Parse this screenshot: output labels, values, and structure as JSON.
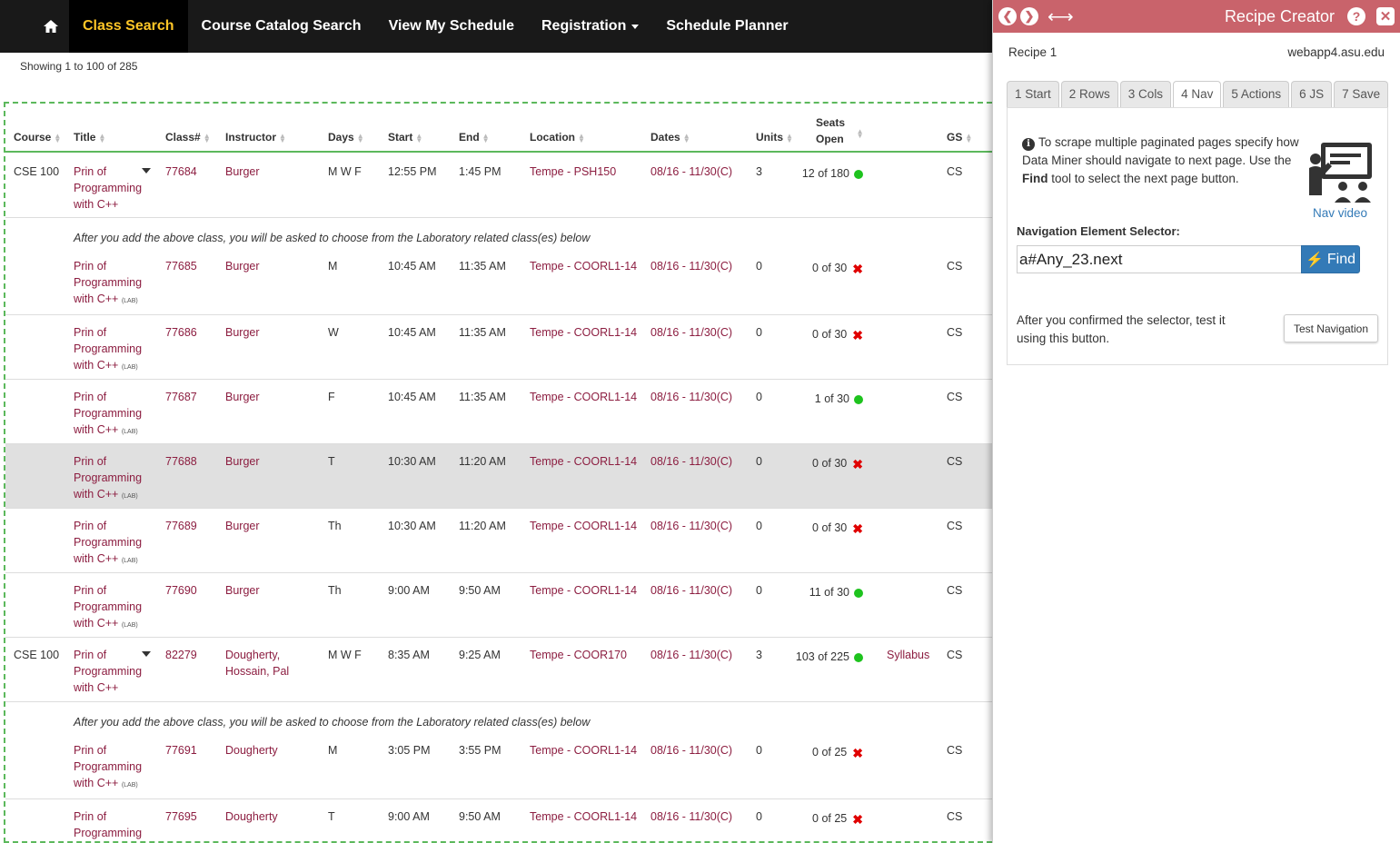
{
  "nav": {
    "items": [
      {
        "label": "Class Search"
      },
      {
        "label": "Course Catalog Search"
      },
      {
        "label": "View My Schedule"
      },
      {
        "label": "Registration"
      },
      {
        "label": "Schedule Planner"
      }
    ]
  },
  "showing": "Showing 1 to 100 of 285",
  "columns": {
    "course": "Course",
    "title": "Title",
    "classnum": "Class#",
    "instructor": "Instructor",
    "days": "Days",
    "start": "Start",
    "end": "End",
    "location": "Location",
    "dates": "Dates",
    "units": "Units",
    "seats1": "Seats",
    "seats2": "Open",
    "gs": "GS"
  },
  "lab_note": "After you add the above class, you will be asked to choose from the Laboratory related class(es) below",
  "rows": [
    {
      "course": "CSE 100",
      "t1": "Prin of",
      "t2": "Programming",
      "t3": "with C++",
      "lab": "",
      "num": "77684",
      "instr1": "Burger",
      "instr2": "",
      "days": "M W F",
      "start": "12:55 PM",
      "end": "1:45 PM",
      "loc": "Tempe - PSH150",
      "dates": "08/16 - 11/30(C)",
      "units": "3",
      "seats": "12  of 180",
      "syllabus": "",
      "gs": "CS"
    },
    {
      "course": "",
      "t1": "Prin of",
      "t2": "Programming",
      "t3": "with C++",
      "lab": "(LAB)",
      "num": "77685",
      "instr1": "Burger",
      "instr2": "",
      "days": "M",
      "start": "10:45 AM",
      "end": "11:35 AM",
      "loc": "Tempe - COORL1-14",
      "dates": "08/16 - 11/30(C)",
      "units": "0",
      "seats": "0  of 30",
      "syllabus": "",
      "gs": "CS"
    },
    {
      "course": "",
      "t1": "Prin of",
      "t2": "Programming",
      "t3": "with C++",
      "lab": "(LAB)",
      "num": "77686",
      "instr1": "Burger",
      "instr2": "",
      "days": "W",
      "start": "10:45 AM",
      "end": "11:35 AM",
      "loc": "Tempe - COORL1-14",
      "dates": "08/16 - 11/30(C)",
      "units": "0",
      "seats": "0  of 30",
      "syllabus": "",
      "gs": "CS"
    },
    {
      "course": "",
      "t1": "Prin of",
      "t2": "Programming",
      "t3": "with C++",
      "lab": "(LAB)",
      "num": "77687",
      "instr1": "Burger",
      "instr2": "",
      "days": "F",
      "start": "10:45 AM",
      "end": "11:35 AM",
      "loc": "Tempe - COORL1-14",
      "dates": "08/16 - 11/30(C)",
      "units": "0",
      "seats": "1  of 30",
      "syllabus": "",
      "gs": "CS"
    },
    {
      "course": "",
      "t1": "Prin of",
      "t2": "Programming",
      "t3": "with C++",
      "lab": "(LAB)",
      "num": "77688",
      "instr1": "Burger",
      "instr2": "",
      "days": "T",
      "start": "10:30 AM",
      "end": "11:20 AM",
      "loc": "Tempe - COORL1-14",
      "dates": "08/16 - 11/30(C)",
      "units": "0",
      "seats": "0  of 30",
      "syllabus": "",
      "gs": "CS"
    },
    {
      "course": "",
      "t1": "Prin of",
      "t2": "Programming",
      "t3": "with C++",
      "lab": "(LAB)",
      "num": "77689",
      "instr1": "Burger",
      "instr2": "",
      "days": "Th",
      "start": "10:30 AM",
      "end": "11:20 AM",
      "loc": "Tempe - COORL1-14",
      "dates": "08/16 - 11/30(C)",
      "units": "0",
      "seats": "0  of 30",
      "syllabus": "",
      "gs": "CS"
    },
    {
      "course": "",
      "t1": "Prin of",
      "t2": "Programming",
      "t3": "with C++",
      "lab": "(LAB)",
      "num": "77690",
      "instr1": "Burger",
      "instr2": "",
      "days": "Th",
      "start": "9:00 AM",
      "end": "9:50 AM",
      "loc": "Tempe - COORL1-14",
      "dates": "08/16 - 11/30(C)",
      "units": "0",
      "seats": "11  of 30",
      "syllabus": "",
      "gs": "CS"
    },
    {
      "course": "CSE 100",
      "t1": "Prin of",
      "t2": "Programming",
      "t3": "with C++",
      "lab": "",
      "num": "82279",
      "instr1": "Dougherty,",
      "instr2": "Hossain, Pal",
      "days": "M W F",
      "start": "8:35 AM",
      "end": "9:25 AM",
      "loc": "Tempe - COOR170",
      "dates": "08/16 - 11/30(C)",
      "units": "3",
      "seats": "103 of 225",
      "syllabus": "Syllabus",
      "gs": "CS"
    },
    {
      "course": "",
      "t1": "Prin of",
      "t2": "Programming",
      "t3": "with C++",
      "lab": "(LAB)",
      "num": "77691",
      "instr1": "Dougherty",
      "instr2": "",
      "days": "M",
      "start": "3:05 PM",
      "end": "3:55 PM",
      "loc": "Tempe - COORL1-14",
      "dates": "08/16 - 11/30(C)",
      "units": "0",
      "seats": "0  of 25",
      "syllabus": "",
      "gs": "CS"
    },
    {
      "course": "",
      "t1": "Prin of",
      "t2": "Programming",
      "t3": "",
      "lab": "",
      "num": "77695",
      "instr1": "Dougherty",
      "instr2": "",
      "days": "T",
      "start": "9:00 AM",
      "end": "9:50 AM",
      "loc": "Tempe - COORL1-14",
      "dates": "08/16 - 11/30(C)",
      "units": "0",
      "seats": "0  of 25",
      "syllabus": "",
      "gs": "CS"
    }
  ],
  "panel": {
    "title": "Recipe Creator",
    "recipe": "Recipe 1",
    "domain": "webapp4.asu.edu",
    "tabs": [
      "1 Start",
      "2 Rows",
      "3 Cols",
      "4 Nav",
      "5 Actions",
      "6 JS",
      "7 Save"
    ],
    "info_1": "To scrape multiple paginated pages specify how Data Miner should navigate to next page. Use the ",
    "info_find": "Find",
    "info_2": " tool to select the next page button.",
    "nav_video": "Nav video",
    "selector_label": "Navigation Element Selector:",
    "selector_value": "a#Any_23.next",
    "find_label": "Find",
    "after_text": "After you confirmed the selector, test it using this button.",
    "test_label": "Test Navigation",
    "accent": "#c9636b",
    "status_open": "#1ec31e",
    "status_closed": "#e00000"
  }
}
